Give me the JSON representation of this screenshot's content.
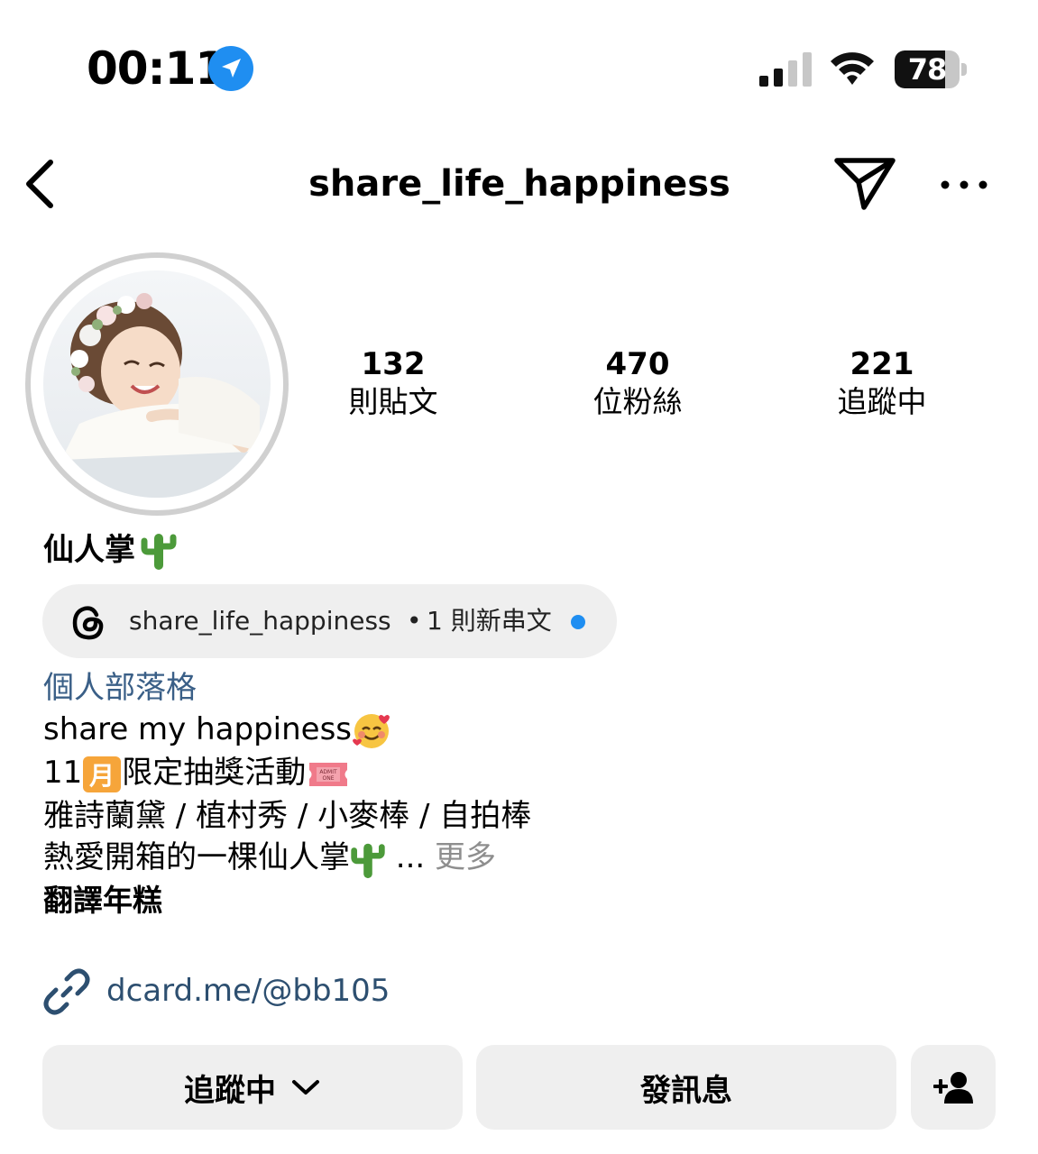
{
  "status_bar": {
    "time": "00:11",
    "battery": "78",
    "battery_level": 0.78,
    "signal_bars_active": 2,
    "icons": [
      "location-arrow-icon",
      "cellular-signal-icon",
      "wifi-icon",
      "battery-icon"
    ]
  },
  "header": {
    "username": "share_life_happiness",
    "icons": [
      "back-chevron-icon",
      "send-message-icon",
      "more-options-icon"
    ]
  },
  "stats": [
    {
      "count": "132",
      "label": "則貼文"
    },
    {
      "count": "470",
      "label": "位粉絲"
    },
    {
      "count": "221",
      "label": "追蹤中"
    }
  ],
  "profile": {
    "name": "仙人掌"
  },
  "threads_badge": {
    "username": "share_life_happiness",
    "separator": "•",
    "new_posts": "1 則新串文"
  },
  "bio": {
    "category": "個人部落格",
    "line1": "share my happiness",
    "line2_prefix": "11",
    "line2_suffix": "限定抽獎活動",
    "line3": "雅詩蘭黛 / 植村秀 / 小麥棒 / 自拍棒",
    "line4": "熱愛開箱的一棵仙人掌",
    "ellipsis": " ...",
    "more": "更多",
    "translate": "翻譯年糕"
  },
  "link": {
    "text": "dcard.me/@bb105"
  },
  "actions": {
    "following": "追蹤中",
    "message": "發訊息"
  },
  "colors": {
    "link_blue": "#2d4f70",
    "category_blue": "#3a5f87",
    "threads_dot": "#1f8ef1",
    "button_bg": "#efefef",
    "location_blue": "#1f8ef1"
  }
}
